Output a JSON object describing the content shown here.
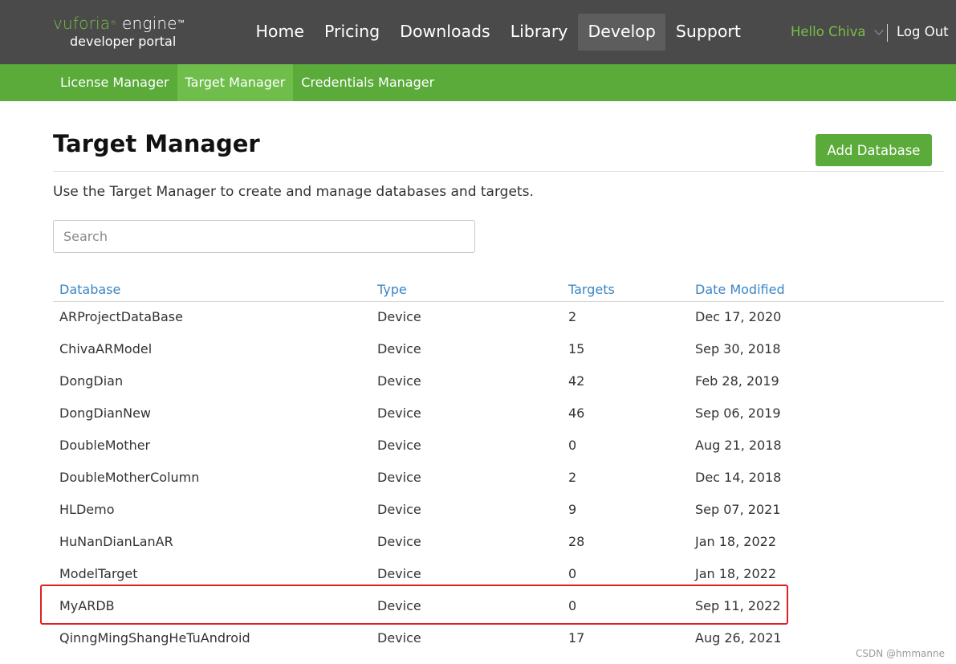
{
  "header": {
    "logo_brand": "vuforia",
    "logo_engine": "engine",
    "logo_tm": "™",
    "logo_sub": "developer portal",
    "nav": [
      {
        "label": "Home"
      },
      {
        "label": "Pricing"
      },
      {
        "label": "Downloads"
      },
      {
        "label": "Library"
      },
      {
        "label": "Develop",
        "active": true
      },
      {
        "label": "Support"
      }
    ],
    "greeting": "Hello Chiva",
    "logout": "Log Out"
  },
  "subnav": [
    {
      "label": "License Manager"
    },
    {
      "label": "Target Manager",
      "active": true
    },
    {
      "label": "Credentials Manager"
    }
  ],
  "page": {
    "title": "Target Manager",
    "add_button": "Add Database",
    "description": "Use the Target Manager to create and manage databases and targets.",
    "search_placeholder": "Search"
  },
  "table": {
    "columns": [
      "Database",
      "Type",
      "Targets",
      "Date Modified"
    ],
    "rows": [
      [
        "ARProjectDataBase",
        "Device",
        "2",
        "Dec 17, 2020"
      ],
      [
        "ChivaARModel",
        "Device",
        "15",
        "Sep 30, 2018"
      ],
      [
        "DongDian",
        "Device",
        "42",
        "Feb 28, 2019"
      ],
      [
        "DongDianNew",
        "Device",
        "46",
        "Sep 06, 2019"
      ],
      [
        "DoubleMother",
        "Device",
        "0",
        "Aug 21, 2018"
      ],
      [
        "DoubleMotherColumn",
        "Device",
        "2",
        "Dec 14, 2018"
      ],
      [
        "HLDemo",
        "Device",
        "9",
        "Sep 07, 2021"
      ],
      [
        "HuNanDianLanAR",
        "Device",
        "28",
        "Jan 18, 2022"
      ],
      [
        "ModelTarget",
        "Device",
        "0",
        "Jan 18, 2022"
      ],
      [
        "MyARDB",
        "Device",
        "0",
        "Sep 11, 2022"
      ],
      [
        "QinngMingShangHeTuAndroid",
        "Device",
        "17",
        "Aug 26, 2021"
      ]
    ]
  },
  "watermark": "CSDN @hmmanne",
  "colors": {
    "topbar": "#4a4a4a",
    "accent_green": "#5aab3a",
    "brand_green": "#76c043",
    "link_blue": "#3a85c4",
    "highlight_red": "#e02020"
  }
}
